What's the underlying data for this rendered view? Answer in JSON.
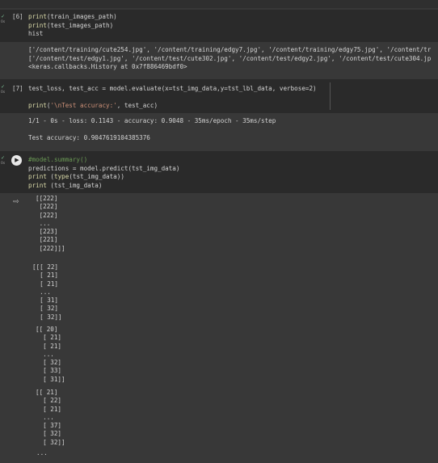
{
  "cell6": {
    "status": "✓",
    "time": "0s",
    "exec_label": "[6]",
    "lines": [
      {
        "fn": "print",
        "rest": "(train_images_path)"
      },
      {
        "fn": "print",
        "rest": "(test_images_path)"
      },
      {
        "fn": "",
        "rest": "hist"
      }
    ],
    "output": [
      "['/content/training/cute254.jpg', '/content/training/edgy7.jpg', '/content/training/edgy75.jpg', '/content/tr",
      "['/content/test/edgy1.jpg', '/content/test/cute302.jpg', '/content/test/edgy2.jpg', '/content/test/cute304.jp",
      "<keras.callbacks.History at 0x7f886469bdf0>"
    ]
  },
  "cell7": {
    "status": "✓",
    "time": "0s",
    "exec_label": "[7]",
    "line1": "test_loss, test_acc = model.evaluate(x=tst_img_data,y=tst_lbl_data, verbose=2)",
    "line2_fn": "print",
    "line2_open": "(",
    "line2_str": "'\\nTest accuracy:'",
    "line2_rest": ", test_acc)",
    "output": [
      "1/1 - 0s - loss: 0.1143 - accuracy: 0.9048 - 35ms/epoch - 35ms/step",
      "",
      "Test accuracy: 0.9047619104385376"
    ]
  },
  "cell8": {
    "status": "✓",
    "time": "0s",
    "comment": "#model.summary()",
    "line2": "predictions = model.predict(tst_img_data)",
    "line3_fn": "print",
    "line3_a": " (",
    "line3_type": "type",
    "line3_b": "(tst_img_data))",
    "line4_fn": "print",
    "line4_rest": " (tst_img_data)",
    "output_icon": "output-icon",
    "output_block1": "[[222]\n [222]\n [222]\n ...\n [223]\n [221]\n [222]]]",
    "output_block2": "[[[ 22]\n  [ 21]\n  [ 21]\n  ...\n  [ 31]\n  [ 32]\n  [ 32]]",
    "output_block3": "[[ 20]\n  [ 21]\n  [ 21]\n  ...\n  [ 32]\n  [ 33]\n  [ 31]]",
    "output_block4": "[[ 21]\n  [ 22]\n  [ 21]\n  ...\n  [ 37]\n  [ 32]\n  [ 32]]",
    "ellipsis": "..."
  }
}
